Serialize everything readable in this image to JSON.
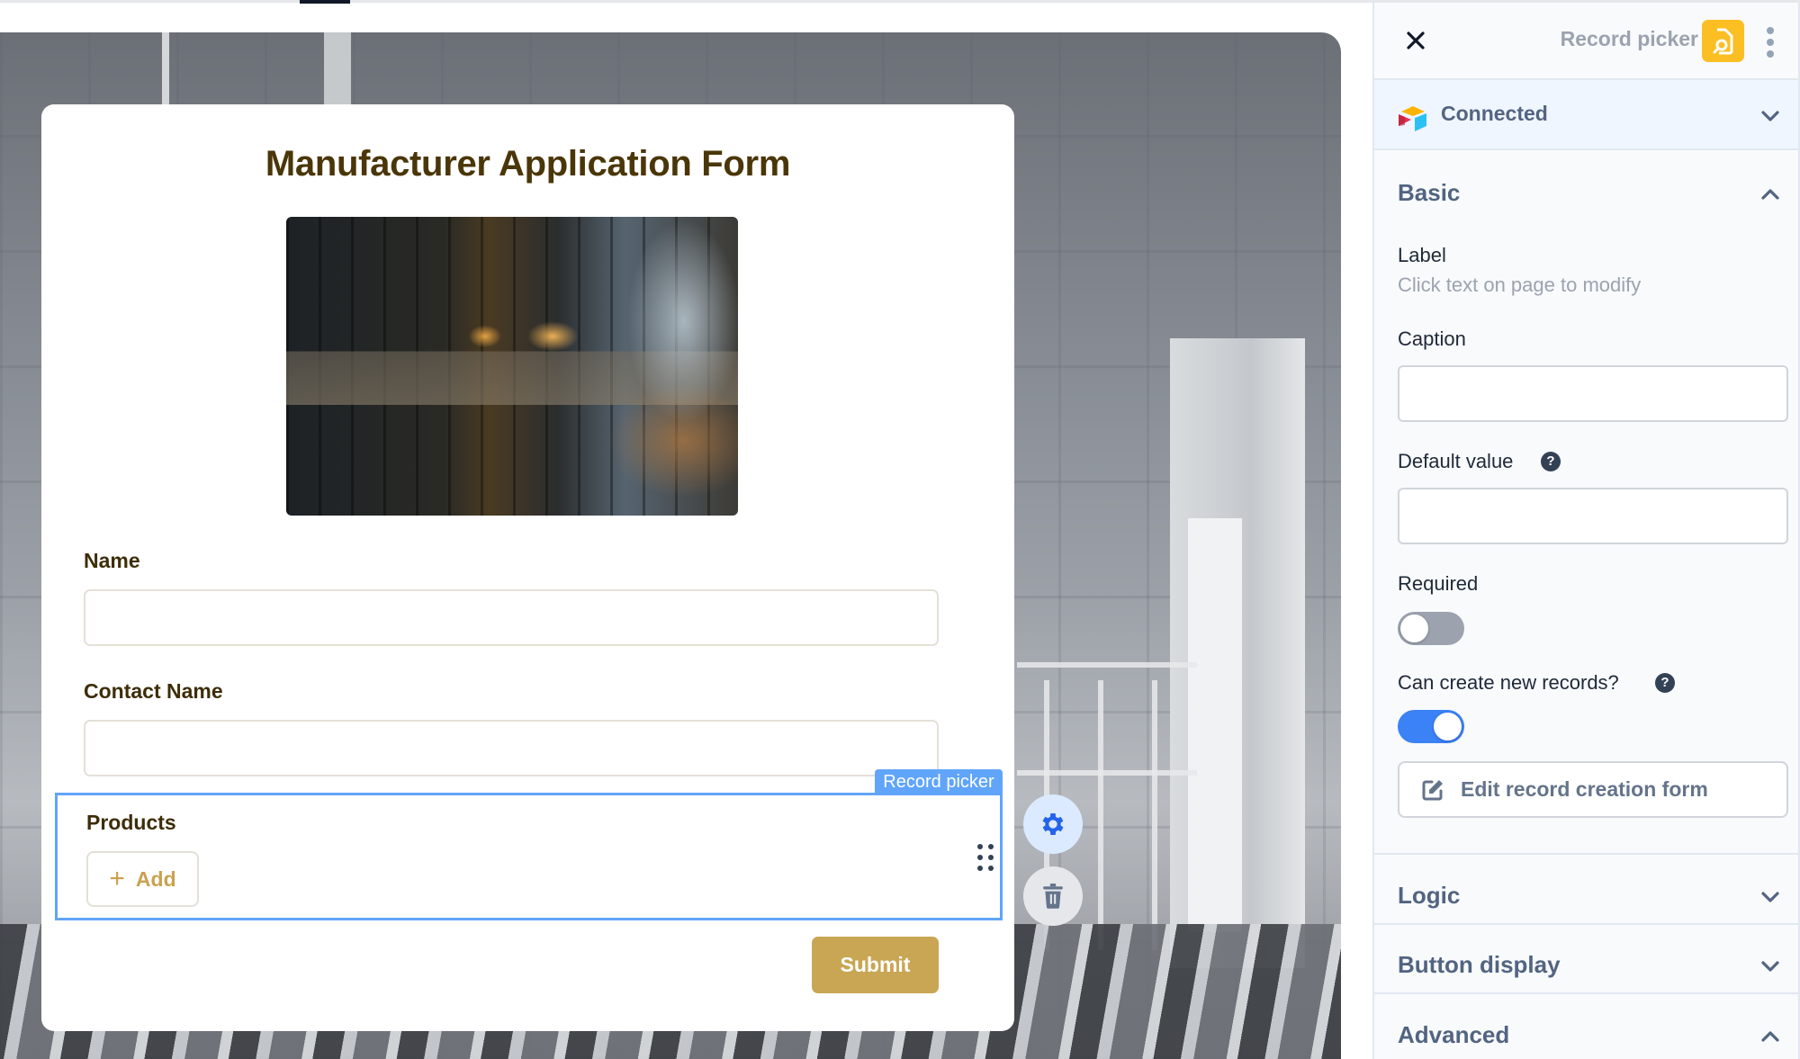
{
  "topbar": {
    "active_tab_indicator": true
  },
  "form": {
    "title": "Manufacturer Application Form",
    "hero_image_alt": "industrial factory interior",
    "fields": [
      {
        "label": "Name",
        "value": "",
        "placeholder": ""
      },
      {
        "label": "Contact Name",
        "value": "",
        "placeholder": ""
      }
    ],
    "record_picker": {
      "badge": "Record picker",
      "label": "Products",
      "add_button": "Add",
      "add_icon": "+"
    },
    "submit_label": "Submit"
  },
  "floating_actions": {
    "settings_icon": "gear-icon",
    "delete_icon": "trash-icon"
  },
  "panel": {
    "title": "Record picker",
    "close_icon": "close-icon",
    "menu_icon": "kebab-icon",
    "connection": {
      "label": "Connected",
      "icon": "airtable-logo"
    },
    "basic": {
      "title": "Basic",
      "label_title": "Label",
      "label_hint": "Click text on page to modify",
      "caption_label": "Caption",
      "caption_value": "",
      "default_value_label": "Default value",
      "default_value": "",
      "help_glyph": "?",
      "required_label": "Required",
      "required": false,
      "can_create_label": "Can create new records?",
      "can_create": true,
      "edit_form_button": "Edit record creation form"
    },
    "sections": [
      {
        "title": "Logic",
        "expanded": false
      },
      {
        "title": "Button display",
        "expanded": false
      },
      {
        "title": "Advanced",
        "expanded": true
      }
    ]
  },
  "colors": {
    "selection": "#60a5fa",
    "submit": "#c9a654",
    "title": "#4a3608",
    "toggle_on": "#3b82f6",
    "type_icon": "#fbbf24"
  }
}
